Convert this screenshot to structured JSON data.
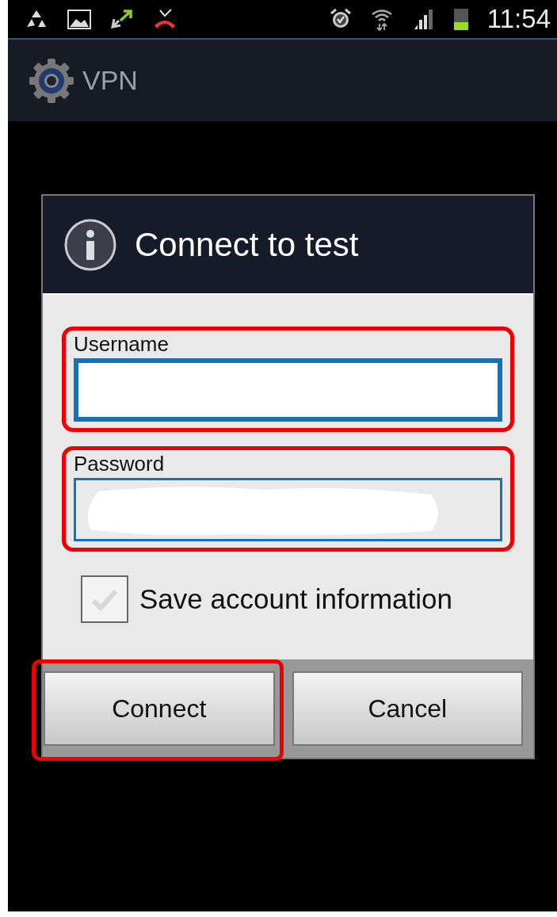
{
  "status_bar": {
    "time": "11:54"
  },
  "action_bar": {
    "title": "VPN"
  },
  "dialog": {
    "title": "Connect to test",
    "fields": [
      {
        "label": "Username",
        "focused": true,
        "redacted": false,
        "highlighted": true
      },
      {
        "label": "Password",
        "focused": false,
        "redacted": true,
        "highlighted": true
      }
    ],
    "checkbox": {
      "label": "Save account information",
      "checked": false
    },
    "buttons": [
      {
        "label": "Connect",
        "highlighted": true
      },
      {
        "label": "Cancel",
        "highlighted": false
      }
    ]
  }
}
